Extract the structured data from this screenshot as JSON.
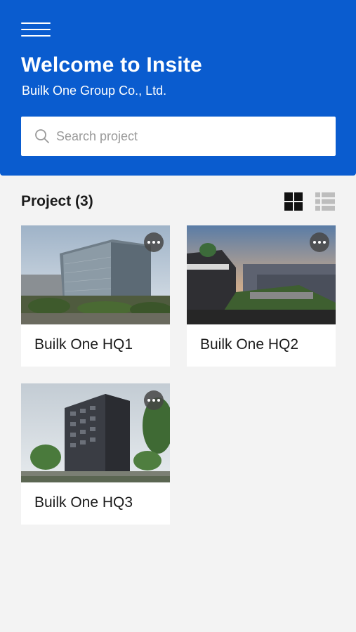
{
  "header": {
    "menu_icon": "hamburger-menu-icon",
    "title": "Welcome to Insite",
    "subtitle": "Builk One Group Co., Ltd."
  },
  "search": {
    "placeholder": "Search project",
    "value": "",
    "icon": "search-icon"
  },
  "projects": {
    "section_title": "Project (3)",
    "view_toggle": {
      "grid_icon": "grid-view-icon",
      "list_icon": "list-view-icon",
      "active": "grid"
    },
    "items": [
      {
        "name": "Builk One HQ1",
        "more_icon": "more-horizontal-icon"
      },
      {
        "name": "Builk One HQ2",
        "more_icon": "more-horizontal-icon"
      },
      {
        "name": "Builk One HQ3",
        "more_icon": "more-horizontal-icon"
      }
    ]
  },
  "colors": {
    "primary": "#0a5ccf",
    "background": "#f3f3f3",
    "card": "#ffffff",
    "text": "#1b1b1b",
    "icon_active": "#111111",
    "icon_inactive": "#bdbdbd"
  }
}
